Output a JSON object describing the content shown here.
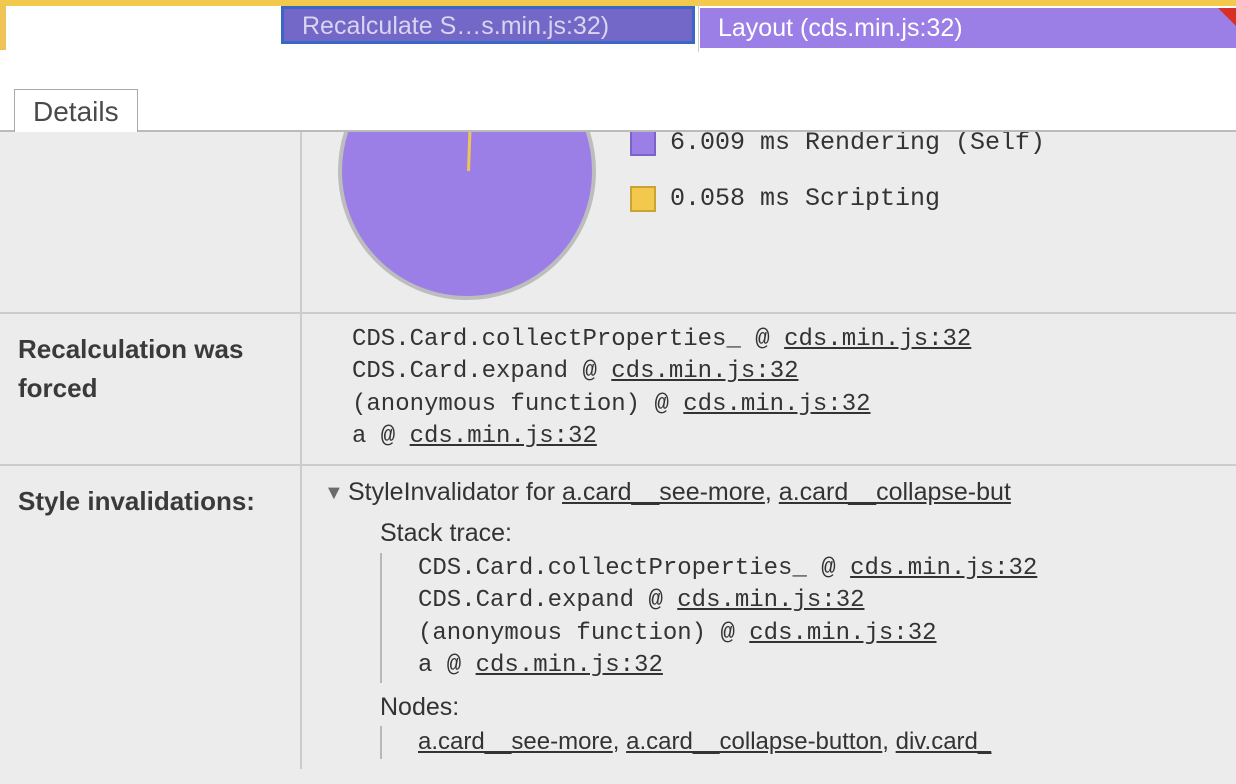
{
  "flame": {
    "selected_label": "Recalculate S…s.min.js:32)",
    "layout_label": "Layout (cds.min.js:32)"
  },
  "tabs": {
    "details": "Details"
  },
  "chart_data": {
    "type": "pie",
    "series": [
      {
        "name": "Rendering (Self)",
        "value": 6.009,
        "unit": "ms",
        "color": "#9b7fe6"
      },
      {
        "name": "Scripting",
        "value": 0.058,
        "unit": "ms",
        "color": "#f2c94c"
      }
    ],
    "legend": [
      {
        "text": "6.009 ms Rendering (Self)"
      },
      {
        "text": "0.058 ms Scripting"
      }
    ]
  },
  "rows": {
    "recalc": {
      "label": "Recalculation was forced",
      "stack": [
        {
          "fn": "CDS.Card.collectProperties_",
          "at": " @ ",
          "src": "cds.min.js:32"
        },
        {
          "fn": "CDS.Card.expand",
          "at": " @ ",
          "src": "cds.min.js:32"
        },
        {
          "fn": "(anonymous function)",
          "at": " @ ",
          "src": "cds.min.js:32"
        },
        {
          "fn": "a",
          "at": " @ ",
          "src": "cds.min.js:32"
        }
      ]
    },
    "styleinv": {
      "label": "Style invalidations:",
      "header_prefix": "StyleInvalidator for ",
      "header_sel1": "a.card__see-more",
      "header_sep": ", ",
      "header_sel2": "a.card__collapse-but",
      "stack_trace_label": "Stack trace:",
      "stack": [
        {
          "fn": "CDS.Card.collectProperties_",
          "at": " @ ",
          "src": "cds.min.js:32"
        },
        {
          "fn": "CDS.Card.expand",
          "at": " @ ",
          "src": "cds.min.js:32"
        },
        {
          "fn": "(anonymous function)",
          "at": " @ ",
          "src": "cds.min.js:32"
        },
        {
          "fn": "a",
          "at": " @ ",
          "src": "cds.min.js:32"
        }
      ],
      "nodes_label": "Nodes:",
      "nodes_sel1": "a.card__see-more",
      "nodes_sep1": ", ",
      "nodes_sel2": "a.card__collapse-button",
      "nodes_sep2": ", ",
      "nodes_sel3": "div.card_"
    }
  }
}
